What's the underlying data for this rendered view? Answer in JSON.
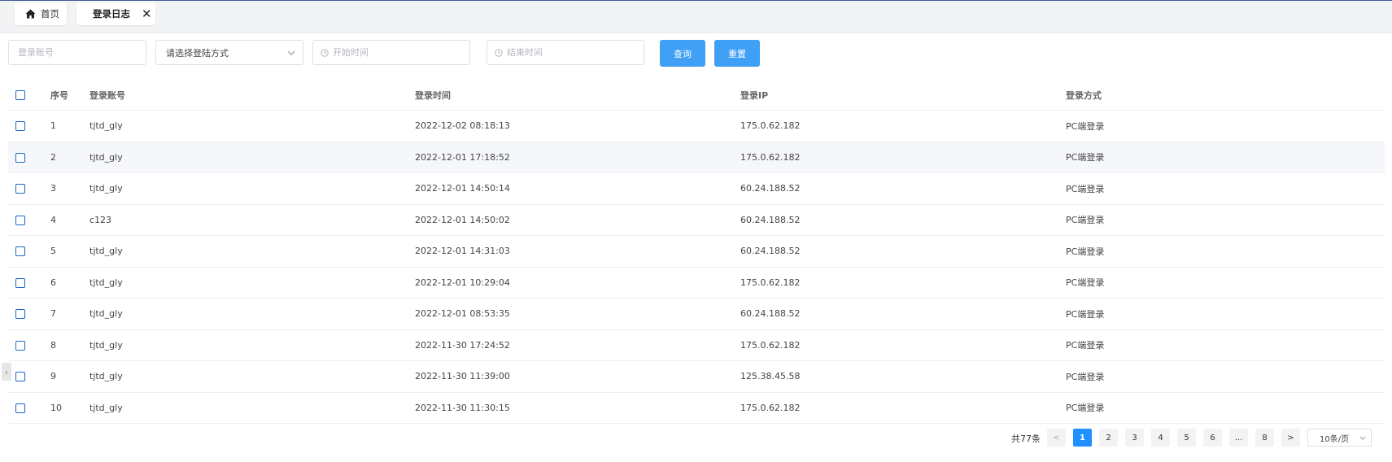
{
  "tabs": {
    "home_label": "首页",
    "active_label": "登录日志",
    "close_glyph": "✕"
  },
  "filters": {
    "account_placeholder": "登录账号",
    "method_value": "请选择登陆方式",
    "start_placeholder": "开始时间",
    "end_placeholder": "结束时间",
    "query_label": "查询",
    "reset_label": "重置"
  },
  "table": {
    "headers": {
      "index": "序号",
      "account": "登录账号",
      "time": "登录时间",
      "ip": "登录IP",
      "method": "登录方式"
    },
    "rows": [
      {
        "index": "1",
        "account": "tjtd_gly",
        "time": "2022-12-02 08:18:13",
        "ip": "175.0.62.182",
        "method": "PC端登录"
      },
      {
        "index": "2",
        "account": "tjtd_gly",
        "time": "2022-12-01 17:18:52",
        "ip": "175.0.62.182",
        "method": "PC端登录"
      },
      {
        "index": "3",
        "account": "tjtd_gly",
        "time": "2022-12-01 14:50:14",
        "ip": "60.24.188.52",
        "method": "PC端登录"
      },
      {
        "index": "4",
        "account": "c123",
        "time": "2022-12-01 14:50:02",
        "ip": "60.24.188.52",
        "method": "PC端登录"
      },
      {
        "index": "5",
        "account": "tjtd_gly",
        "time": "2022-12-01 14:31:03",
        "ip": "60.24.188.52",
        "method": "PC端登录"
      },
      {
        "index": "6",
        "account": "tjtd_gly",
        "time": "2022-12-01 10:29:04",
        "ip": "175.0.62.182",
        "method": "PC端登录"
      },
      {
        "index": "7",
        "account": "tjtd_gly",
        "time": "2022-12-01 08:53:35",
        "ip": "60.24.188.52",
        "method": "PC端登录"
      },
      {
        "index": "8",
        "account": "tjtd_gly",
        "time": "2022-11-30 17:24:52",
        "ip": "175.0.62.182",
        "method": "PC端登录"
      },
      {
        "index": "9",
        "account": "tjtd_gly",
        "time": "2022-11-30 11:39:00",
        "ip": "125.38.45.58",
        "method": "PC端登录"
      },
      {
        "index": "10",
        "account": "tjtd_gly",
        "time": "2022-11-30 11:30:15",
        "ip": "175.0.62.182",
        "method": "PC端登录"
      }
    ]
  },
  "pagination": {
    "total": "共77条",
    "prev": "<",
    "next": ">",
    "ellipsis": "...",
    "pages": [
      "1",
      "2",
      "3",
      "4",
      "5",
      "6"
    ],
    "last_page": "8",
    "current": "1",
    "page_size": "10条/页"
  },
  "colors": {
    "primary": "#3fa0f5",
    "active_page": "#1e90ff",
    "checkbox": "#1a66d0"
  },
  "icons": {
    "home": "home-icon",
    "close": "close-icon",
    "clock": "clock-icon",
    "chevron": "chevron-down-icon",
    "collapse": "chevron-left-icon"
  }
}
